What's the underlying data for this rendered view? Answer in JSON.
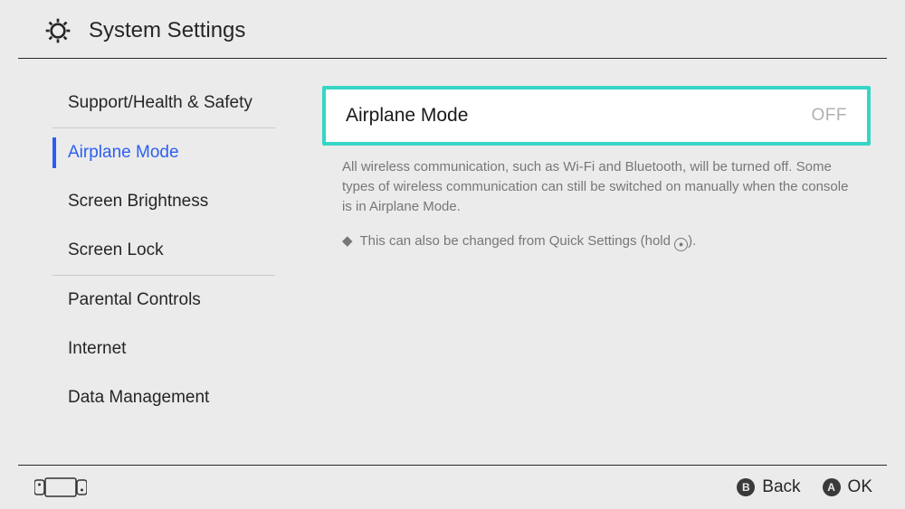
{
  "header": {
    "title": "System Settings"
  },
  "sidebar": {
    "groups": [
      {
        "items": [
          {
            "label": "Support/Health & Safety"
          }
        ]
      },
      {
        "items": [
          {
            "label": "Airplane Mode",
            "active": true
          },
          {
            "label": "Screen Brightness"
          },
          {
            "label": "Screen Lock"
          }
        ]
      },
      {
        "items": [
          {
            "label": "Parental Controls"
          },
          {
            "label": "Internet"
          },
          {
            "label": "Data Management"
          }
        ]
      }
    ]
  },
  "content": {
    "setting": {
      "label": "Airplane Mode",
      "value": "OFF"
    },
    "description": "All wireless communication, such as Wi-Fi and Bluetooth, will be turned off. Some types of wireless communication can still be switched on manually when the console is in Airplane Mode.",
    "hint_prefix": "◆",
    "hint_text": "This can also be changed from Quick Settings (hold ",
    "hint_button": "⊙",
    "hint_suffix": ")."
  },
  "footer": {
    "back": {
      "glyph": "B",
      "label": "Back"
    },
    "ok": {
      "glyph": "A",
      "label": "OK"
    }
  }
}
